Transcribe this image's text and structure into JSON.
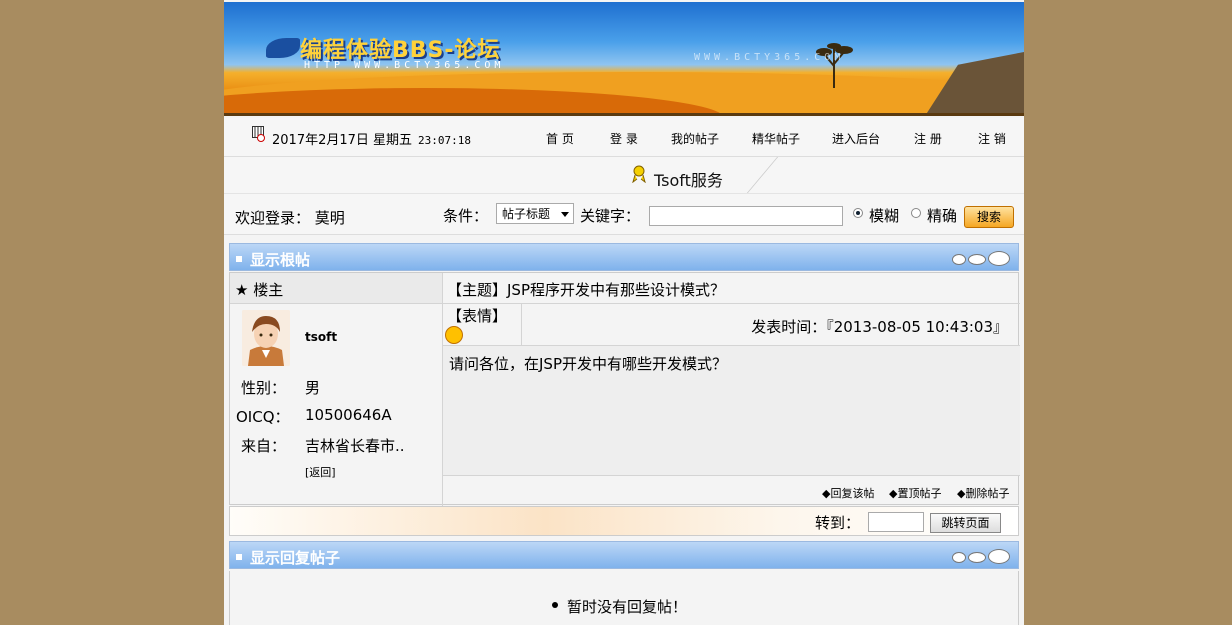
{
  "banner": {
    "logo_text": "编程体验BBS-论坛",
    "logo_url": "HTTP  WWW.BCTY365.COM",
    "faint_url": "WWW.BCTY365.COM"
  },
  "navbar": {
    "date": "2017年2月17日 星期五",
    "time": "23:07:18",
    "items": [
      "首 页",
      "登 录",
      "我的帖子",
      "精华帖子",
      "进入后台",
      "注 册",
      "注 销"
    ]
  },
  "service": {
    "label": "Tsoft服务"
  },
  "search": {
    "welcome": "欢迎登录： 莫明",
    "condition_label": "条件：",
    "condition_value": "帖子标题",
    "keyword_label": "关键字：",
    "keyword_value": "",
    "radio_fuzzy": "模糊",
    "radio_exact": "精确",
    "selected_mode": "模糊",
    "search_button": "搜索"
  },
  "root_section": {
    "title": "显示根帖"
  },
  "post": {
    "owner_label": "★ 楼主",
    "subject": "【主题】JSP程序开发中有那些设计模式？",
    "username": "tsoft",
    "gender_label": "性别：",
    "gender": "男",
    "oicq_label": "OICQ：",
    "oicq": "10500646A",
    "from_label": "来自：",
    "from": "吉林省长春市..",
    "back": "[返回]",
    "face_label": "【表情】",
    "time_label": "发表时间：『2013-08-05 10:43:03』",
    "content": "请问各位，在JSP开发中有哪些开发模式？",
    "actions": [
      "◆回复该帖",
      "◆置顶帖子",
      "◆删除帖子"
    ]
  },
  "jump": {
    "label": "转到：",
    "value": "",
    "button": "跳转页面"
  },
  "reply_section": {
    "title": "显示回复帖子",
    "empty": "暂时没有回复帖！"
  },
  "colors": {
    "background": "#a88c60",
    "panel_header": "#7fb2ec",
    "search_button": "#f5a623"
  }
}
